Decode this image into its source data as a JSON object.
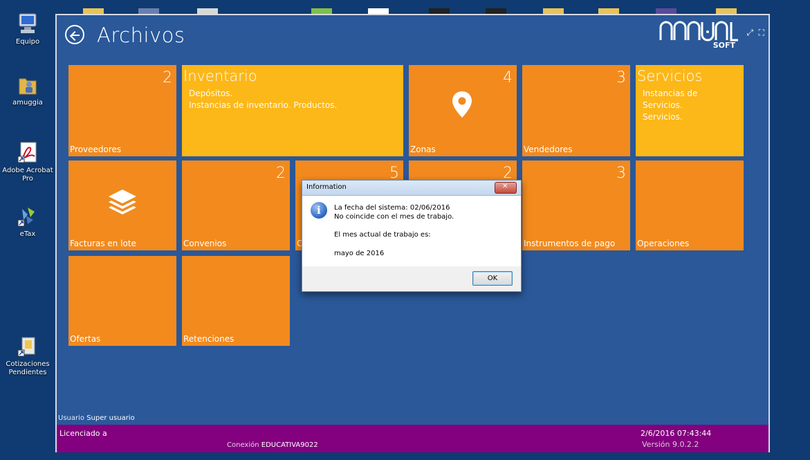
{
  "desktop": {
    "icons": [
      {
        "label": "Equipo"
      },
      {
        "label": "amuggia"
      },
      {
        "label": "Adobe Acrobat Pro"
      },
      {
        "label": "eTax"
      },
      {
        "label": "Cotizaciones Pendientes"
      }
    ]
  },
  "app": {
    "title": "Archivos",
    "logo": "ANNUAL",
    "logo_sub": "SOFT",
    "colors": {
      "orange": "#f28a1e",
      "yellow": "#fcb719",
      "background": "#2a5899",
      "footer": "#83007e"
    }
  },
  "tiles": [
    {
      "name": "Proveedores",
      "count": "2"
    },
    {
      "name": "Inventario",
      "desc1": "Depósitos.",
      "desc2": "Instancias de inventario. Productos."
    },
    {
      "name": "Zonas",
      "count": "4",
      "icon": "map-pin-icon"
    },
    {
      "name": "Vendedores",
      "count": "3"
    },
    {
      "name": "Servicios",
      "desc1": "Instancias de",
      "desc2": "Servicios.",
      "desc3": "Servicios."
    },
    {
      "name": "Facturas en lote",
      "icon": "layers-icon"
    },
    {
      "name": "Convenios",
      "count": "2"
    },
    {
      "name": "C",
      "count": "5"
    },
    {
      "name": "",
      "count": "2"
    },
    {
      "name": "Instrumentos de pago",
      "count": "3"
    },
    {
      "name": "Operaciones"
    },
    {
      "name": "Ofertas"
    },
    {
      "name": "Retenciones"
    }
  ],
  "footer": {
    "user_label": "Usuario",
    "user_value": "Super usuario",
    "licensed": "Licenciado a",
    "connection_label": "Conexión",
    "connection_value": "EDUCATIVA9022",
    "datetime": "2/6/2016 07:43:44",
    "version": "Versión 9.0.2.2"
  },
  "dialog": {
    "title": "Information",
    "line1": "La fecha del sistema: 02/06/2016",
    "line2": "No coincide con el mes de trabajo.",
    "line3": "El mes actual de trabajo es:",
    "line4": "mayo de 2016",
    "ok_label": "OK"
  }
}
